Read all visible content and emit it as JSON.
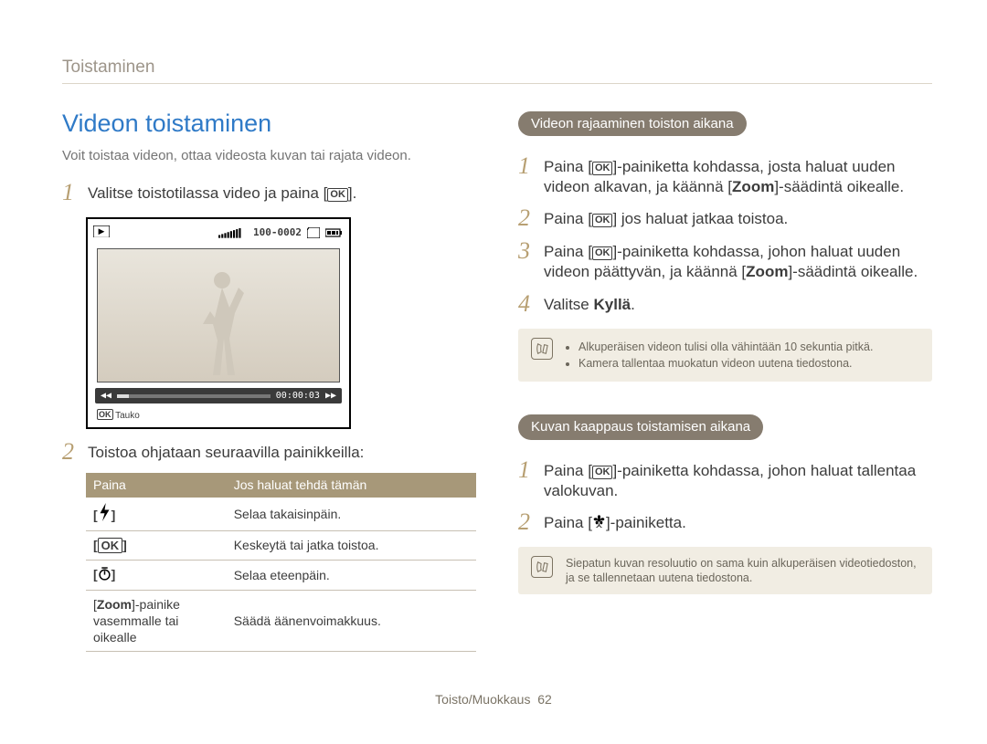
{
  "chapter": "Toistaminen",
  "title": "Videon toistaminen",
  "subtitle": "Voit toistaa videon, ottaa videosta kuvan tai rajata videon.",
  "left": {
    "step1": "Valitse toistotilassa video ja paina [",
    "step1_tail": "].",
    "cam": {
      "counter": "100-0002",
      "time": "00:00:03",
      "pause": "Tauko",
      "ok": "OK"
    },
    "step2": "Toistoa ohjataan seuraavilla painikkeilla:",
    "table": {
      "head1": "Paina",
      "head2": "Jos haluat tehdä tämän",
      "ok": "OK",
      "row1b": "Selaa takaisinpäin.",
      "row2b": "Keskeytä tai jatka toistoa.",
      "row3b": "Selaa eteenpäin.",
      "row4a_pre": "[",
      "row4a_zoom": "Zoom",
      "row4a_post": "]-painike vasemmalle tai oikealle",
      "row4b": "Säädä äänenvoimakkuus."
    }
  },
  "right": {
    "heading_trim": "Videon rajaaminen toiston aikana",
    "trim": {
      "s1_pre": "Paina [",
      "s1_post": "]-painiketta kohdassa, josta haluat uuden videon alkavan, ja käännä [",
      "s1_zoom": "Zoom",
      "s1_tail": "]-säädintä oikealle.",
      "s2_pre": "Paina [",
      "s2_post": "] jos haluat jatkaa toistoa.",
      "s3_pre": "Paina [",
      "s3_post": "]-painiketta kohdassa, johon haluat uuden videon päättyvän, ja käännä [",
      "s3_zoom": "Zoom",
      "s3_tail": "]-säädintä oikealle.",
      "s4_pre": "Valitse ",
      "s4_bold": "Kyllä",
      "s4_post": "."
    },
    "note1": {
      "li1": "Alkuperäisen videon tulisi olla vähintään 10 sekuntia pitkä.",
      "li2": "Kamera tallentaa muokatun videon uutena tiedostona."
    },
    "heading_capture": "Kuvan kaappaus toistamisen aikana",
    "cap": {
      "s1_pre": "Paina [",
      "s1_post": "]-painiketta kohdassa, johon haluat tallentaa valokuvan.",
      "s2_pre": "Paina [",
      "s2_post": "]-painiketta."
    },
    "note2": "Siepatun kuvan resoluutio on sama kuin alkuperäisen videotiedoston, ja se tallennetaan uutena tiedostona."
  },
  "footer_section": "Toisto/Muokkaus",
  "footer_page": "62",
  "icons": {
    "ok": "OK"
  }
}
